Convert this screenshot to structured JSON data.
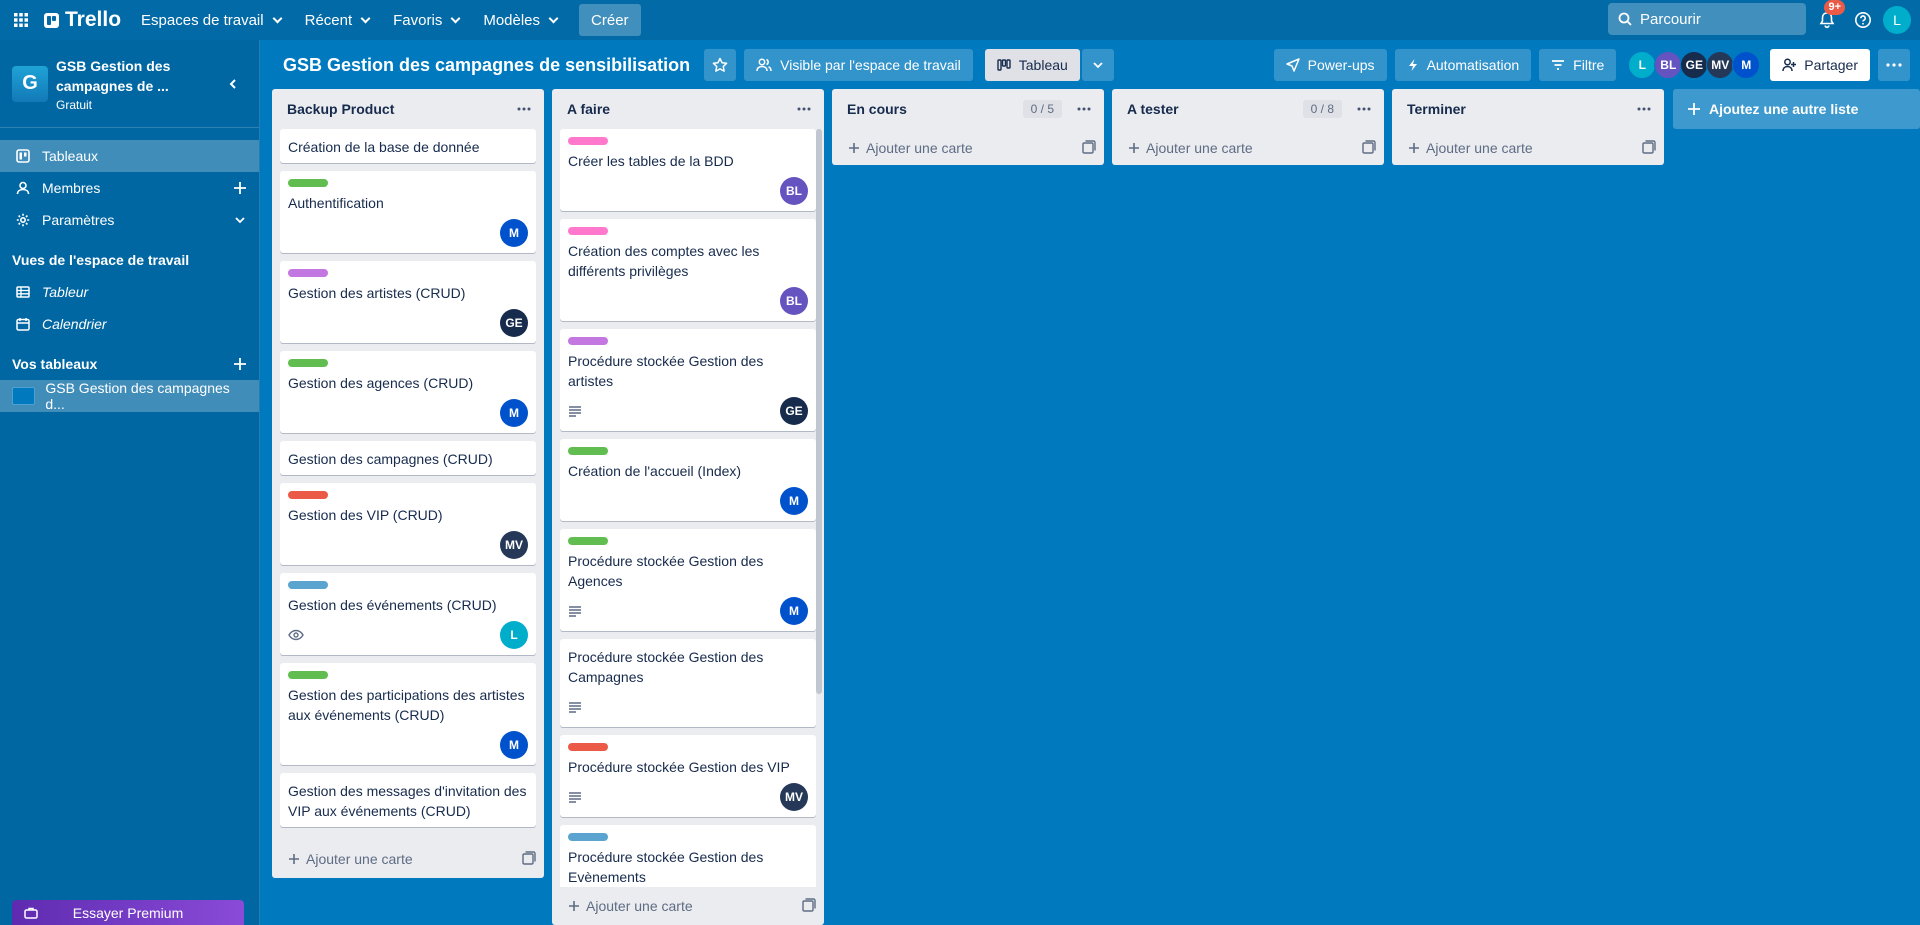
{
  "topbar": {
    "logo": "Trello",
    "nav": [
      {
        "label": "Espaces de travail"
      },
      {
        "label": "Récent"
      },
      {
        "label": "Favoris"
      },
      {
        "label": "Modèles"
      }
    ],
    "create": "Créer",
    "search_placeholder": "Parcourir",
    "notifications_badge": "9+",
    "user_initial": "L"
  },
  "sidebar": {
    "workspace_initial": "G",
    "workspace_name": "GSB Gestion des campagnes de ...",
    "workspace_plan": "Gratuit",
    "items": [
      {
        "label": "Tableaux"
      },
      {
        "label": "Membres"
      },
      {
        "label": "Paramètres"
      }
    ],
    "views_title": "Vues de l'espace de travail",
    "views": [
      {
        "label": "Tableur"
      },
      {
        "label": "Calendrier"
      }
    ],
    "boards_title": "Vos tableaux",
    "boards": [
      {
        "label": "GSB Gestion des campagnes d..."
      }
    ],
    "premium": "Essayer Premium"
  },
  "board": {
    "title": "GSB Gestion des campagnes de sensibilisation",
    "visibility": "Visible par l'espace de travail",
    "view": "Tableau",
    "powerups": "Power-ups",
    "automation": "Automatisation",
    "filter": "Filtre",
    "share": "Partager",
    "members": [
      {
        "initials": "L",
        "color": "#00aecc"
      },
      {
        "initials": "BL",
        "color": "#6554c0"
      },
      {
        "initials": "GE",
        "color": "#172b4d"
      },
      {
        "initials": "MV",
        "color": "#253858"
      },
      {
        "initials": "M",
        "color": "#0052cc"
      }
    ]
  },
  "lists": [
    {
      "title": "Backup Product",
      "count": "",
      "add_card": "Ajouter une carte",
      "cards": [
        {
          "title": "Création de la base de donnée",
          "label": "",
          "member": "",
          "member_color": "",
          "desc": false,
          "watch": false
        },
        {
          "title": "Authentification",
          "label": "#61bd4f",
          "member": "M",
          "member_color": "#0052cc",
          "desc": false,
          "watch": false
        },
        {
          "title": "Gestion des artistes (CRUD)",
          "label": "#c377e0",
          "member": "GE",
          "member_color": "#172b4d",
          "desc": false,
          "watch": false
        },
        {
          "title": "Gestion des agences (CRUD)",
          "label": "#61bd4f",
          "member": "M",
          "member_color": "#0052cc",
          "desc": false,
          "watch": false
        },
        {
          "title": "Gestion des campagnes (CRUD)",
          "label": "",
          "member": "",
          "member_color": "",
          "desc": false,
          "watch": false
        },
        {
          "title": "Gestion des VIP (CRUD)",
          "label": "#eb5a46",
          "member": "MV",
          "member_color": "#253858",
          "desc": false,
          "watch": false
        },
        {
          "title": "Gestion des événements (CRUD)",
          "label": "#5ba4cf",
          "member": "L",
          "member_color": "#00aecc",
          "desc": false,
          "watch": true
        },
        {
          "title": "Gestion des participations des artistes aux événements (CRUD)",
          "label": "#61bd4f",
          "member": "M",
          "member_color": "#0052cc",
          "desc": false,
          "watch": false
        },
        {
          "title": "Gestion des messages d'invitation des VIP aux événements (CRUD)",
          "label": "",
          "member": "",
          "member_color": "",
          "desc": false,
          "watch": false
        }
      ]
    },
    {
      "title": "A faire",
      "count": "",
      "add_card": "Ajouter une carte",
      "cards": [
        {
          "title": "Créer les tables de la BDD",
          "label": "#ff78cb",
          "member": "BL",
          "member_color": "#6554c0",
          "desc": false,
          "watch": false
        },
        {
          "title": "Création des comptes avec les différents privilèges",
          "label": "#ff78cb",
          "member": "BL",
          "member_color": "#6554c0",
          "desc": false,
          "watch": false
        },
        {
          "title": "Procédure stockée Gestion des artistes",
          "label": "#c377e0",
          "member": "GE",
          "member_color": "#172b4d",
          "desc": true,
          "watch": false
        },
        {
          "title": "Création de l'accueil (Index)",
          "label": "#61bd4f",
          "member": "M",
          "member_color": "#0052cc",
          "desc": false,
          "watch": false
        },
        {
          "title": "Procédure stockée Gestion des Agences",
          "label": "#61bd4f",
          "member": "M",
          "member_color": "#0052cc",
          "desc": true,
          "watch": false
        },
        {
          "title": "Procédure stockée Gestion des Campagnes",
          "label": "",
          "member": "",
          "member_color": "",
          "desc": true,
          "watch": false
        },
        {
          "title": "Procédure stockée Gestion des VIP",
          "label": "#eb5a46",
          "member": "MV",
          "member_color": "#253858",
          "desc": true,
          "watch": false
        },
        {
          "title": "Procédure stockée Gestion des Evènements",
          "label": "#5ba4cf",
          "member": "",
          "member_color": "",
          "desc": false,
          "watch": false
        }
      ]
    },
    {
      "title": "En cours",
      "count": "0 / 5",
      "add_card": "Ajouter une carte",
      "cards": []
    },
    {
      "title": "A tester",
      "count": "0 / 8",
      "add_card": "Ajouter une carte",
      "cards": []
    },
    {
      "title": "Terminer",
      "count": "",
      "add_card": "Ajouter une carte",
      "cards": []
    }
  ],
  "add_list": "Ajoutez une autre liste"
}
